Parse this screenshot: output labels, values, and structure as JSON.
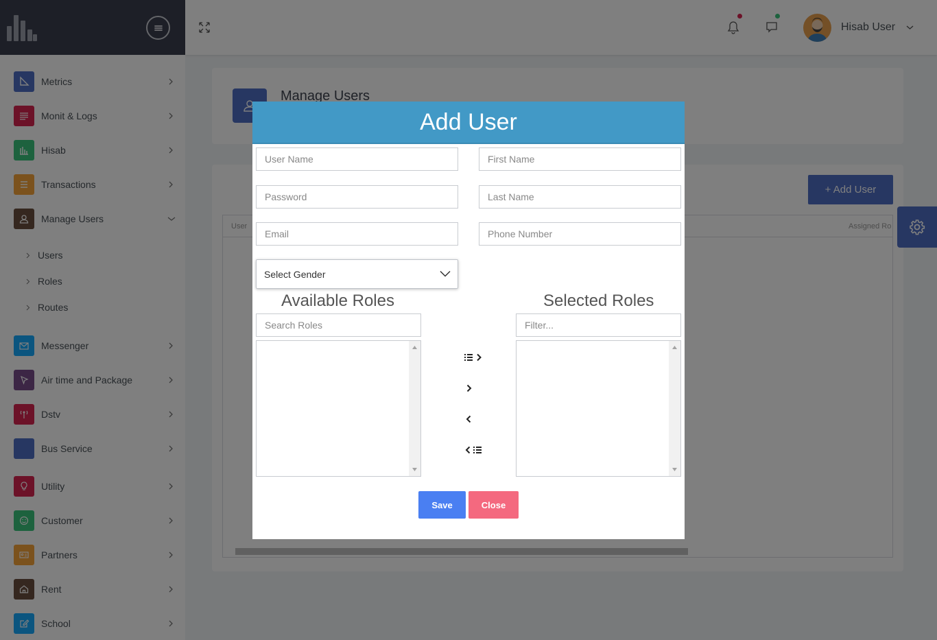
{
  "header": {
    "user_name": "Hisab User",
    "notification_dot_color": "#d92550",
    "chat_dot_color": "#3ac47d"
  },
  "sidebar": {
    "items": [
      {
        "label": "Metrics",
        "icon": "ruler-triangle-icon",
        "color": "#4f6fc4"
      },
      {
        "label": "Monit & Logs",
        "icon": "list-lines-icon",
        "color": "#d92550"
      },
      {
        "label": "Hisab",
        "icon": "bar-chart-icon",
        "color": "#3ac47d"
      },
      {
        "label": "Transactions",
        "icon": "menu-lines-icon",
        "color": "#f7a53b"
      },
      {
        "label": "Manage Users",
        "icon": "user-icon",
        "color": "#6b4f3f"
      },
      {
        "label": "Messenger",
        "icon": "envelope-icon",
        "color": "#16aaff"
      },
      {
        "label": "Air time and Package",
        "icon": "cursor-arrow-icon",
        "color": "#794c8a"
      },
      {
        "label": "Dstv",
        "icon": "antenna-icon",
        "color": "#d92550"
      },
      {
        "label": "Bus Service",
        "icon": "bus-icon",
        "color": "#4f6fc4"
      },
      {
        "label": "Utility",
        "icon": "lightbulb-icon",
        "color": "#d92550"
      },
      {
        "label": "Customer",
        "icon": "smile-icon",
        "color": "#3ac47d"
      },
      {
        "label": "Partners",
        "icon": "id-card-icon",
        "color": "#f7a53b"
      },
      {
        "label": "Rent",
        "icon": "house-icon",
        "color": "#6b4f3f"
      },
      {
        "label": "School",
        "icon": "pencil-square-icon",
        "color": "#16aaff"
      }
    ],
    "sub_items": [
      "Users",
      "Roles",
      "Routes"
    ]
  },
  "page": {
    "title": "Manage Users",
    "add_user_label": "+ Add User",
    "grid_columns": [
      "User",
      "Assigned Ro"
    ]
  },
  "modal": {
    "title": "Add User",
    "fields": {
      "user_name": "User Name",
      "first_name": "First Name",
      "password": "Password",
      "last_name": "Last Name",
      "email": "Email",
      "phone": "Phone Number"
    },
    "gender_select": "Select Gender",
    "available_roles_title": "Available Roles",
    "selected_roles_title": "Selected Roles",
    "search_roles_placeholder": "Search Roles",
    "filter_placeholder": "Filter...",
    "save_label": "Save",
    "close_label": "Close"
  }
}
